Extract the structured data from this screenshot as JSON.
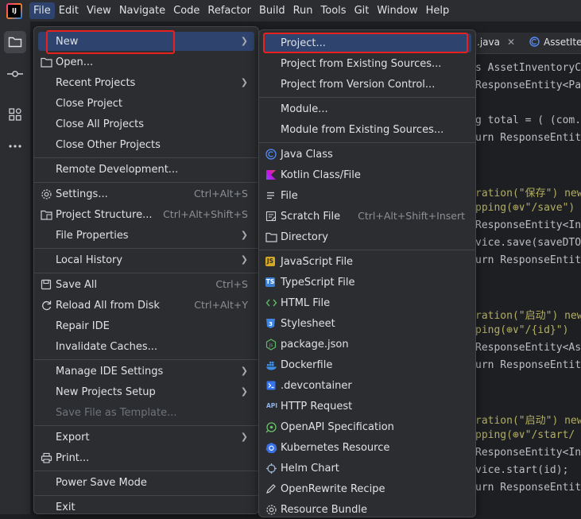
{
  "menubar": {
    "logo_text": "IJ",
    "items": [
      "File",
      "Edit",
      "View",
      "Navigate",
      "Code",
      "Refactor",
      "Build",
      "Run",
      "Tools",
      "Git",
      "Window",
      "Help"
    ]
  },
  "editor": {
    "tabs": [
      ".java",
      "AssetIte"
    ],
    "lines": [
      {
        "text": "s AssetInventoryC",
        "color": "#bcbec4"
      },
      {
        "text": "ResponseEntity<Pa",
        "color": "#bcbec4"
      },
      {
        "text": "",
        "color": "#bcbec4"
      },
      {
        "text": "g total = ( (com.",
        "color": "#bcbec4"
      },
      {
        "text": "urn ResponseEntit",
        "color": "#bcbec4"
      },
      {
        "text": "",
        "color": "#bcbec4"
      },
      {
        "text": "",
        "color": "#bcbec4"
      },
      {
        "text": "ration(\"保存\")  new",
        "color": "#b3ae60"
      },
      {
        "text": "pping(⊕∨\"/save\")",
        "color": "#b3ae60"
      },
      {
        "text": "ResponseEntity<In",
        "color": "#bcbec4"
      },
      {
        "text": "vice.save(saveDTO",
        "color": "#bcbec4"
      },
      {
        "text": "urn ResponseEntit",
        "color": "#bcbec4"
      },
      {
        "text": "",
        "color": "#bcbec4"
      },
      {
        "text": "",
        "color": "#bcbec4"
      },
      {
        "text": "ration(\"启动\")  new",
        "color": "#b3ae60"
      },
      {
        "text": "ping(⊕∨\"/{id}\")",
        "color": "#b3ae60"
      },
      {
        "text": "ResponseEntity<As",
        "color": "#bcbec4"
      },
      {
        "text": "urn ResponseEntit",
        "color": "#bcbec4"
      },
      {
        "text": "",
        "color": "#bcbec4"
      },
      {
        "text": "",
        "color": "#bcbec4"
      },
      {
        "text": "ration(\"启动\")  new",
        "color": "#b3ae60"
      },
      {
        "text": "pping(⊕∨\"/start/",
        "color": "#b3ae60"
      },
      {
        "text": "ResponseEntity<In",
        "color": "#bcbec4"
      },
      {
        "text": "vice.start(id);",
        "color": "#bcbec4"
      },
      {
        "text": "urn ResponseEntit",
        "color": "#bcbec4"
      }
    ]
  },
  "file_menu": {
    "items": [
      {
        "label": "New",
        "submenu": true,
        "icon": "",
        "highlighted": true
      },
      {
        "label": "Open...",
        "icon": "folder-icon"
      },
      {
        "label": "Recent Projects",
        "submenu": true,
        "icon": ""
      },
      {
        "label": "Close Project",
        "icon": ""
      },
      {
        "label": "Close All Projects",
        "icon": ""
      },
      {
        "label": "Close Other Projects",
        "icon": ""
      },
      {
        "sep": true
      },
      {
        "label": "Remote Development...",
        "icon": ""
      },
      {
        "sep": true
      },
      {
        "label": "Settings...",
        "shortcut": "Ctrl+Alt+S",
        "icon": "gear-icon"
      },
      {
        "label": "Project Structure...",
        "shortcut": "Ctrl+Alt+Shift+S",
        "icon": "project-structure-icon"
      },
      {
        "label": "File Properties",
        "submenu": true,
        "icon": ""
      },
      {
        "sep": true
      },
      {
        "label": "Local History",
        "submenu": true,
        "icon": ""
      },
      {
        "sep": true
      },
      {
        "label": "Save All",
        "shortcut": "Ctrl+S",
        "icon": "save-icon"
      },
      {
        "label": "Reload All from Disk",
        "shortcut": "Ctrl+Alt+Y",
        "icon": "reload-icon"
      },
      {
        "label": "Repair IDE",
        "icon": ""
      },
      {
        "label": "Invalidate Caches...",
        "icon": ""
      },
      {
        "sep": true
      },
      {
        "label": "Manage IDE Settings",
        "submenu": true,
        "icon": ""
      },
      {
        "label": "New Projects Setup",
        "submenu": true,
        "icon": ""
      },
      {
        "label": "Save File as Template...",
        "icon": "",
        "disabled": true
      },
      {
        "sep": true
      },
      {
        "label": "Export",
        "submenu": true,
        "icon": ""
      },
      {
        "label": "Print...",
        "icon": "print-icon"
      },
      {
        "sep": true
      },
      {
        "label": "Power Save Mode",
        "icon": ""
      },
      {
        "sep": true
      },
      {
        "label": "Exit",
        "icon": ""
      }
    ]
  },
  "new_menu": {
    "items": [
      {
        "label": "Project...",
        "icon": "",
        "highlighted": true
      },
      {
        "label": "Project from Existing Sources...",
        "icon": ""
      },
      {
        "label": "Project from Version Control...",
        "icon": ""
      },
      {
        "sep": true
      },
      {
        "label": "Module...",
        "icon": ""
      },
      {
        "label": "Module from Existing Sources...",
        "icon": ""
      },
      {
        "sep": true
      },
      {
        "label": "Java Class",
        "icon": "java-class-icon"
      },
      {
        "label": "Kotlin Class/File",
        "icon": "kotlin-icon"
      },
      {
        "label": "File",
        "icon": "file-icon"
      },
      {
        "label": "Scratch File",
        "shortcut": "Ctrl+Alt+Shift+Insert",
        "icon": "scratch-file-icon"
      },
      {
        "label": "Directory",
        "icon": "folder-icon"
      },
      {
        "sep": true
      },
      {
        "label": "JavaScript File",
        "icon": "javascript-icon",
        "badge": "JS"
      },
      {
        "label": "TypeScript File",
        "icon": "typescript-icon",
        "badge": "TS"
      },
      {
        "label": "HTML File",
        "icon": "html-icon"
      },
      {
        "label": "Stylesheet",
        "icon": "css-icon"
      },
      {
        "label": "package.json",
        "icon": "nodejs-icon"
      },
      {
        "label": "Dockerfile",
        "icon": "docker-icon"
      },
      {
        "label": ".devcontainer",
        "icon": "devcontainer-icon"
      },
      {
        "label": "HTTP Request",
        "icon": "http-request-icon",
        "badge": "API"
      },
      {
        "label": "OpenAPI Specification",
        "icon": "openapi-icon"
      },
      {
        "label": "Kubernetes Resource",
        "icon": "kubernetes-icon"
      },
      {
        "label": "Helm Chart",
        "icon": "helm-icon"
      },
      {
        "label": "OpenRewrite Recipe",
        "icon": "openrewrite-icon"
      },
      {
        "label": "Resource Bundle",
        "icon": "resource-bundle-icon"
      }
    ]
  },
  "colors": {
    "highlight": "#2e436e",
    "menu_bg": "#2b2d30",
    "annotation_red": "#e8201e"
  }
}
